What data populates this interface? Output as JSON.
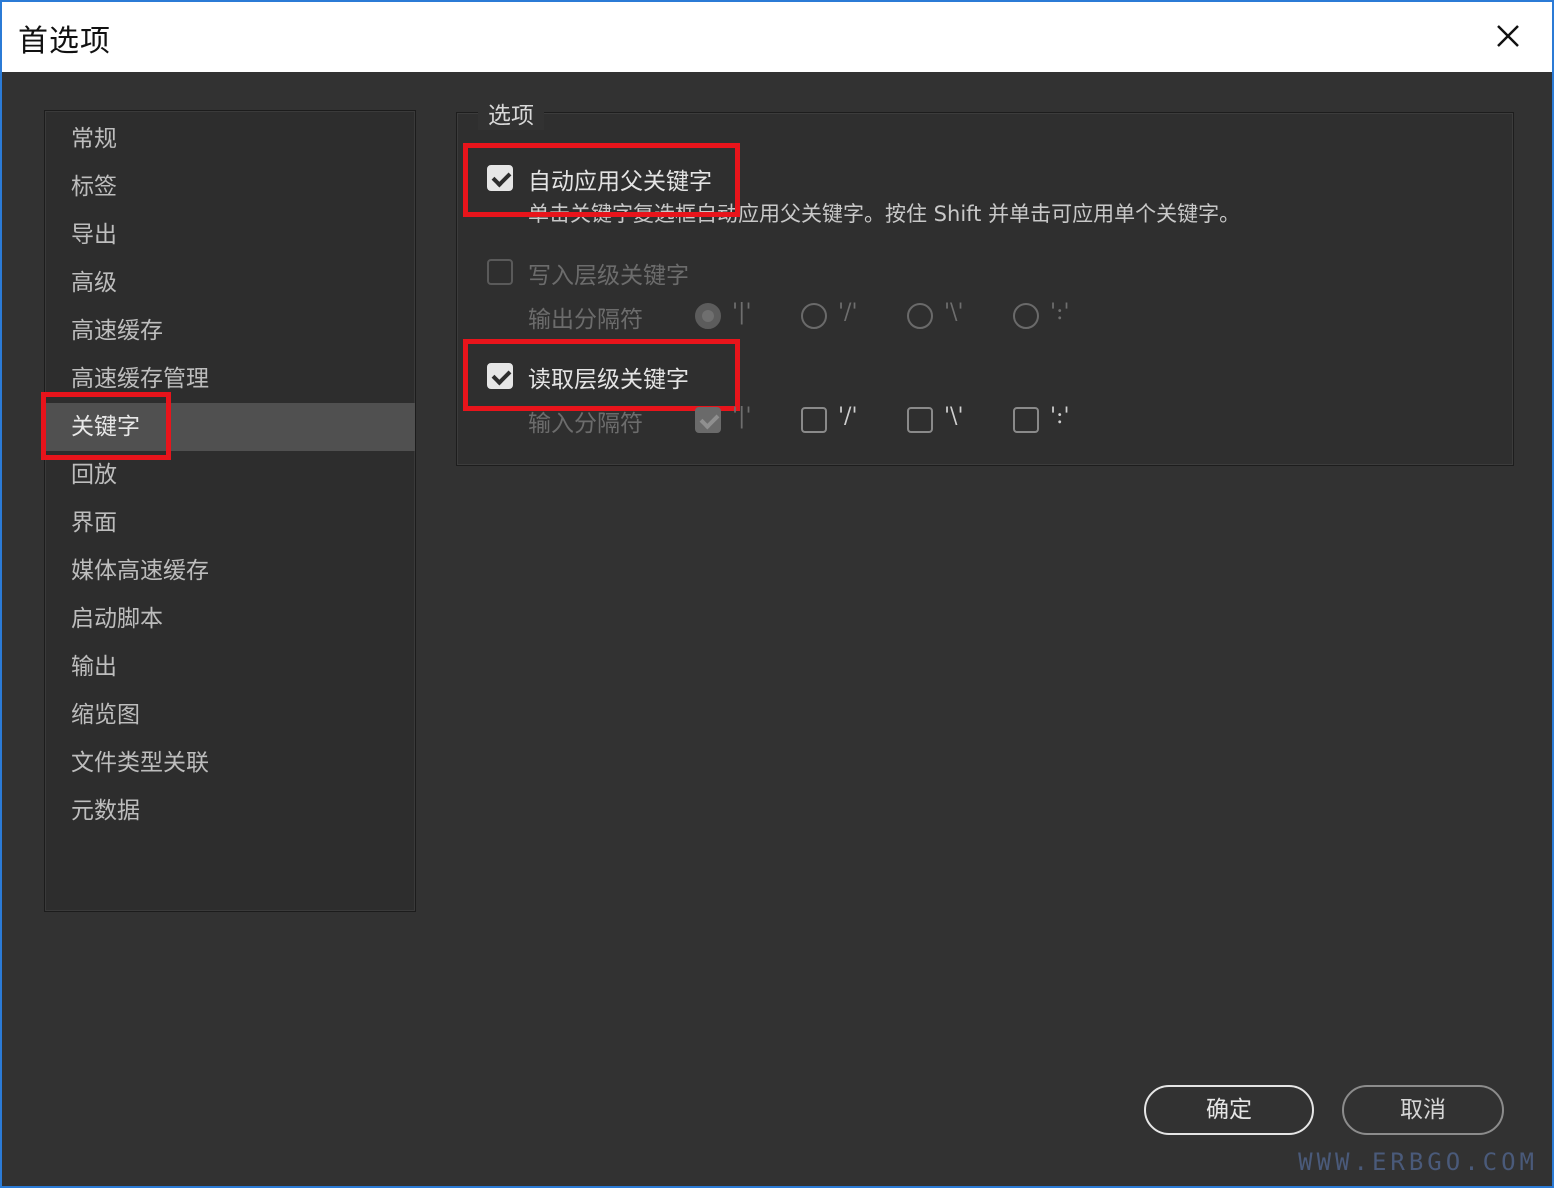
{
  "window": {
    "title": "首选项"
  },
  "sidebar": {
    "items": [
      {
        "label": "常规"
      },
      {
        "label": "标签"
      },
      {
        "label": "导出"
      },
      {
        "label": "高级"
      },
      {
        "label": "高速缓存"
      },
      {
        "label": "高速缓存管理"
      },
      {
        "label": "关键字",
        "selected": true
      },
      {
        "label": "回放"
      },
      {
        "label": "界面"
      },
      {
        "label": "媒体高速缓存"
      },
      {
        "label": "启动脚本"
      },
      {
        "label": "输出"
      },
      {
        "label": "缩览图"
      },
      {
        "label": "文件类型关联"
      },
      {
        "label": "元数据"
      }
    ]
  },
  "options": {
    "legend": "选项",
    "auto_apply": {
      "label": "自动应用父关键字",
      "checked": true,
      "description": "单击关键字复选框自动应用父关键字。按住 Shift 并单击可应用单个关键字。"
    },
    "write_hierarchical": {
      "label": "写入层级关键字",
      "checked": false,
      "enabled": false,
      "separator_label": "输出分隔符",
      "separators": [
        "'|'",
        "'/'",
        "'\\'",
        "':'"
      ],
      "selected_separator": "'|'"
    },
    "read_hierarchical": {
      "label": "读取层级关键字",
      "checked": true,
      "separator_label": "输入分隔符",
      "separators": [
        "'|'",
        "'/'",
        "'\\'",
        "':'"
      ],
      "checked_separators": [
        "'|'"
      ]
    }
  },
  "buttons": {
    "ok": "确定",
    "cancel": "取消"
  },
  "watermark": "WWW.ERBGO.COM",
  "colors": {
    "highlight": "#e8141b",
    "window_border": "#2b7bd6",
    "panel_bg": "#323232"
  }
}
